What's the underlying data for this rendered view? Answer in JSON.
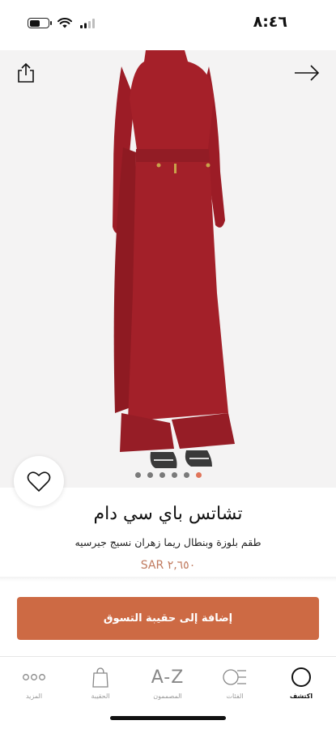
{
  "status_bar": {
    "time": "٨:٤٦"
  },
  "product": {
    "brand": "تشاتس باي سي دام",
    "name": "طقم بلوزة وبنطال ريما زهران نسيج جيرسيه",
    "price": "٢,٦٥٠ SAR",
    "image_count": 6,
    "active_image_index": 6
  },
  "actions": {
    "add_to_bag_label": "إضافة إلى حقيبة التسوق"
  },
  "tabbar": {
    "more": "المزيد",
    "bag": "الحقيبة",
    "designers_icon_text": "A-Z",
    "designers": "المصممون",
    "categories": "الفئات",
    "discover": "اكتشف"
  },
  "colors": {
    "accent": "#cd6a44",
    "price": "#c07a5e",
    "garment": "#a3202a",
    "active_dot": "#e0755a"
  },
  "icons": [
    "battery-icon",
    "wifi-icon",
    "signal-icon",
    "share-icon",
    "arrow-right-icon",
    "heart-icon",
    "more-dots-icon",
    "bag-icon",
    "categories-icon",
    "discover-icon"
  ]
}
